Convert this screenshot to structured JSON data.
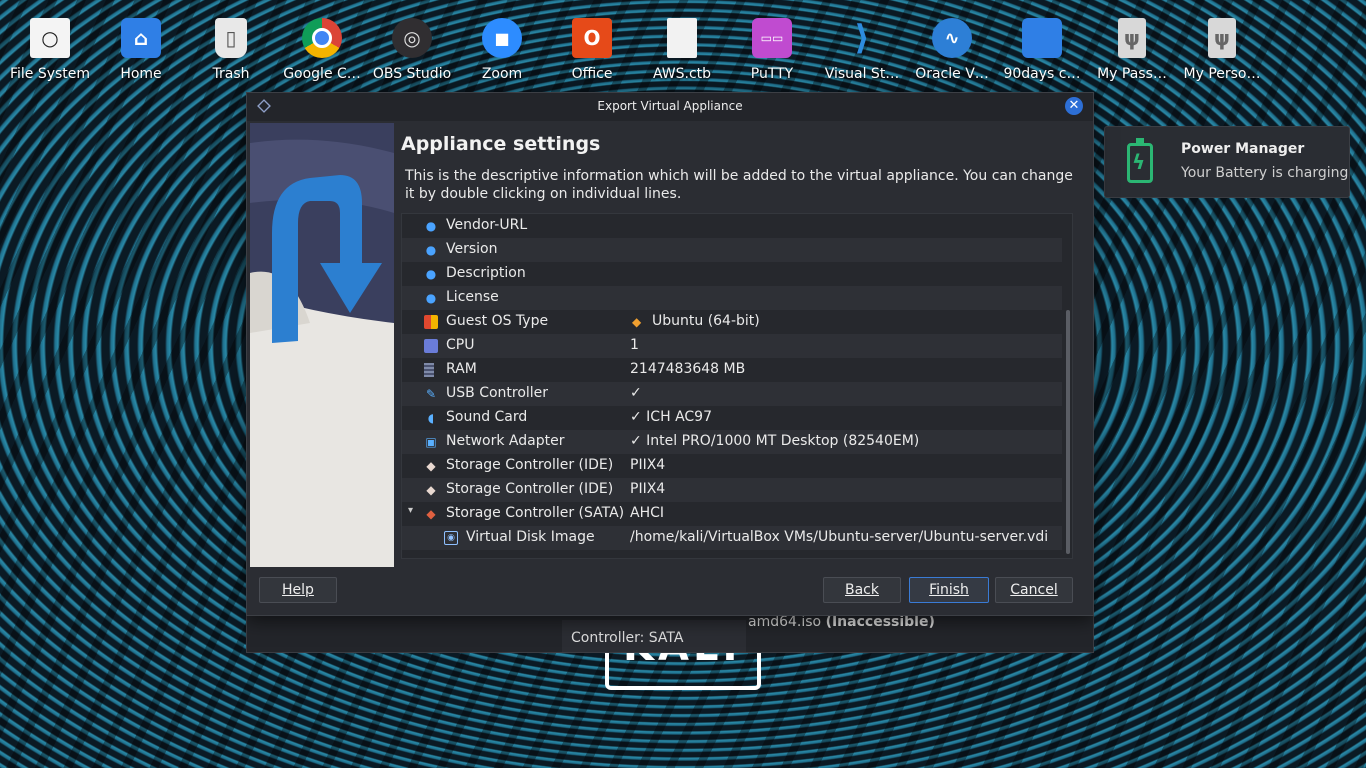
{
  "desktop": {
    "icons": [
      {
        "label": "File System",
        "icon": "file-system-icon"
      },
      {
        "label": "Home",
        "icon": "home-folder-icon"
      },
      {
        "label": "Trash",
        "icon": "trash-icon"
      },
      {
        "label": "Google C…",
        "icon": "chrome-icon"
      },
      {
        "label": "OBS Studio",
        "icon": "obs-icon"
      },
      {
        "label": "Zoom",
        "icon": "zoom-icon"
      },
      {
        "label": "Office",
        "icon": "office-icon"
      },
      {
        "label": "AWS.ctb",
        "icon": "document-icon"
      },
      {
        "label": "PuTTY",
        "icon": "putty-icon"
      },
      {
        "label": "Visual St…",
        "icon": "vscode-icon"
      },
      {
        "label": "Oracle V…",
        "icon": "oracle-vm-icon"
      },
      {
        "label": "90days c…",
        "icon": "folder-icon"
      },
      {
        "label": "My Pass…",
        "icon": "usb-drive-icon"
      },
      {
        "label": "My Perso…",
        "icon": "usb-drive-icon"
      }
    ]
  },
  "logo": {
    "text": "KALI"
  },
  "notification": {
    "title": "Power Manager",
    "body": "Your Battery is charging",
    "accent": "#2bb673"
  },
  "background_window": {
    "iso_name": "amd64.iso",
    "iso_status": "(Inaccessible)",
    "controller": "Controller: SATA"
  },
  "dialog": {
    "title": "Export Virtual Appliance",
    "heading": "Appliance settings",
    "description": "This is the descriptive information which will be added to the virtual appliance. You can change it by double clicking on individual lines.",
    "rows": [
      {
        "name": "Vendor-URL",
        "value": "",
        "icon": "comment-bubble-icon"
      },
      {
        "name": "Version",
        "value": "",
        "icon": "comment-bubble-icon"
      },
      {
        "name": "Description",
        "value": "",
        "icon": "comment-bubble-icon"
      },
      {
        "name": "License",
        "value": "",
        "icon": "comment-bubble-icon"
      },
      {
        "name": "Guest OS Type",
        "value": "Ubuntu (64-bit)",
        "icon": "os-type-icon"
      },
      {
        "name": "CPU",
        "value": "1",
        "icon": "cpu-icon"
      },
      {
        "name": "RAM",
        "value": "2147483648 MB",
        "icon": "ram-icon"
      },
      {
        "name": "USB Controller",
        "value": "✓",
        "icon": "usb-icon"
      },
      {
        "name": "Sound Card",
        "value": "✓  ICH AC97",
        "icon": "sound-icon"
      },
      {
        "name": "Network Adapter",
        "value": "✓  Intel PRO/1000 MT Desktop (82540EM)",
        "icon": "network-icon"
      },
      {
        "name": "Storage Controller (IDE)",
        "value": "PIIX4",
        "icon": "storage-icon"
      },
      {
        "name": "Storage Controller (IDE)",
        "value": "PIIX4",
        "icon": "storage-icon"
      },
      {
        "name": "Storage Controller (SATA)",
        "value": "AHCI",
        "icon": "storage-icon"
      },
      {
        "name": "Virtual Disk Image",
        "value": "/home/kali/VirtualBox VMs/Ubuntu-server/Ubuntu-server.vdi",
        "icon": "disk-image-icon"
      }
    ],
    "buttons": {
      "help": "Help",
      "back": "Back",
      "finish": "Finish",
      "cancel": "Cancel"
    }
  }
}
